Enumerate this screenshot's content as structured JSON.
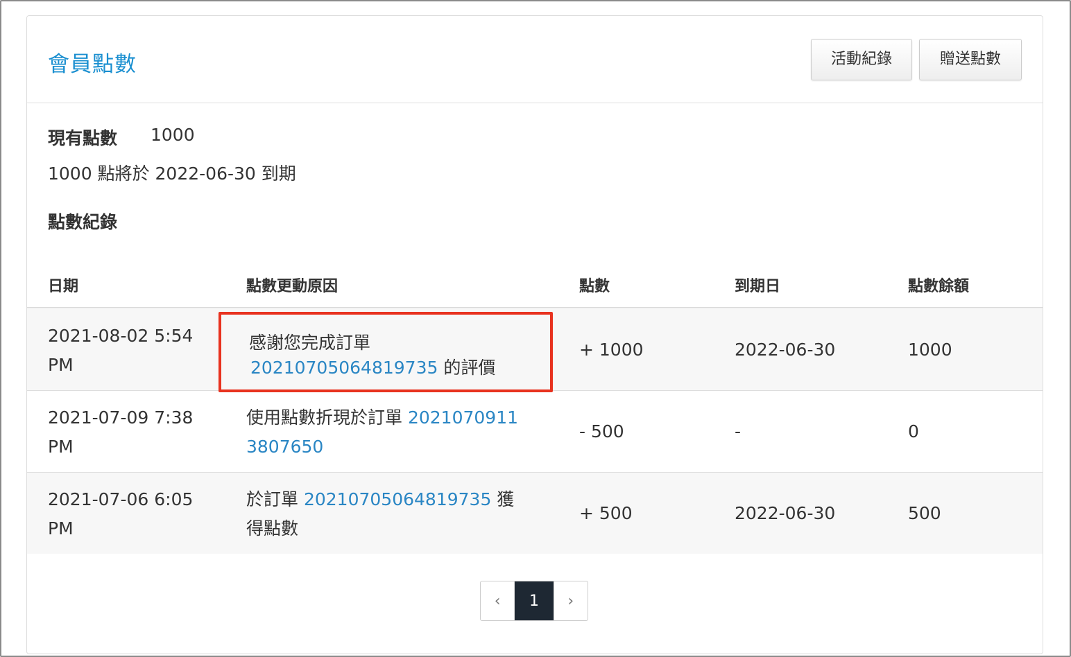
{
  "header": {
    "title": "會員點數",
    "buttons": {
      "activity": "活動紀錄",
      "gift": "贈送點數"
    }
  },
  "summary": {
    "current_label": "現有點數",
    "current_value": "1000",
    "expire_note": "1000 點將於 2022-06-30 到期",
    "records_label": "點數紀錄"
  },
  "table": {
    "columns": [
      "日期",
      "點數更動原因",
      "點數",
      "到期日",
      "點數餘額"
    ],
    "rows": [
      {
        "date_line1": "2021-08-02 5:54",
        "date_line2": "PM",
        "reason_prefix": "感謝您完成訂單",
        "reason_link": "20210705064819735",
        "reason_suffix": " 的評價",
        "points": "+ 1000",
        "expire": "2022-06-30",
        "balance": "1000"
      },
      {
        "date_line1": "2021-07-09 7:38",
        "date_line2": "PM",
        "reason_prefix": "使用點數折現於訂單 ",
        "reason_link_part1": "2021070911",
        "reason_link_part2": "3807650",
        "points": "- 500",
        "expire": "-",
        "balance": "0"
      },
      {
        "date_line1": "2021-07-06 6:05",
        "date_line2": "PM",
        "reason_prefix": "於訂單 ",
        "reason_link": "20210705064819735",
        "reason_suffix_line1": " 獲",
        "reason_suffix_line2": "得點數",
        "points": "+ 500",
        "expire": "2022-06-30",
        "balance": "500"
      }
    ]
  },
  "pagination": {
    "prev": "‹",
    "current": "1",
    "next": "›"
  },
  "colors": {
    "accent": "#1a8fd0",
    "link": "#2a86c4",
    "highlight": "#e8321f",
    "pager_active": "#1e2833"
  }
}
